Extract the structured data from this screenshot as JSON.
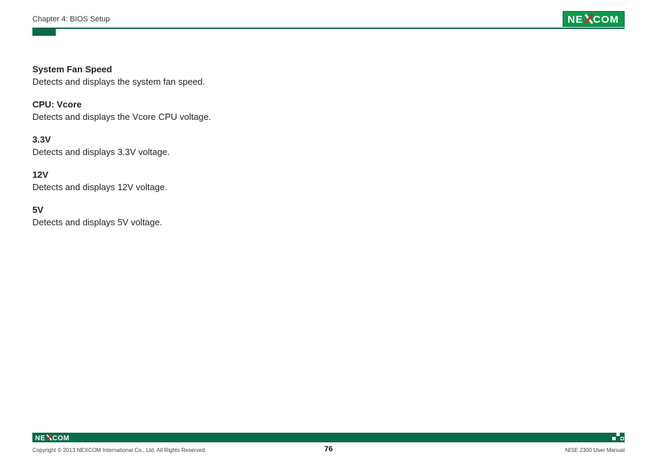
{
  "header": {
    "chapter": "Chapter 4: BIOS Setup"
  },
  "brand": {
    "name_left": "NE",
    "name_right": "COM",
    "color_bg": "#0b9a4a",
    "color_border": "#0b6b49"
  },
  "content": {
    "items": [
      {
        "heading": "System Fan Speed",
        "desc": "Detects and displays the system fan speed."
      },
      {
        "heading": "CPU: Vcore",
        "desc": "Detects and displays the Vcore CPU voltage."
      },
      {
        "heading": "3.3V",
        "desc": "Detects and displays 3.3V voltage."
      },
      {
        "heading": "12V",
        "desc": "Detects and displays 12V voltage."
      },
      {
        "heading": "5V",
        "desc": "Detects and displays 5V voltage."
      }
    ]
  },
  "footer": {
    "copyright": "Copyright © 2013 NEXCOM International Co., Ltd. All Rights Reserved.",
    "page_number": "76",
    "manual": "NISE 2300 User Manual"
  }
}
